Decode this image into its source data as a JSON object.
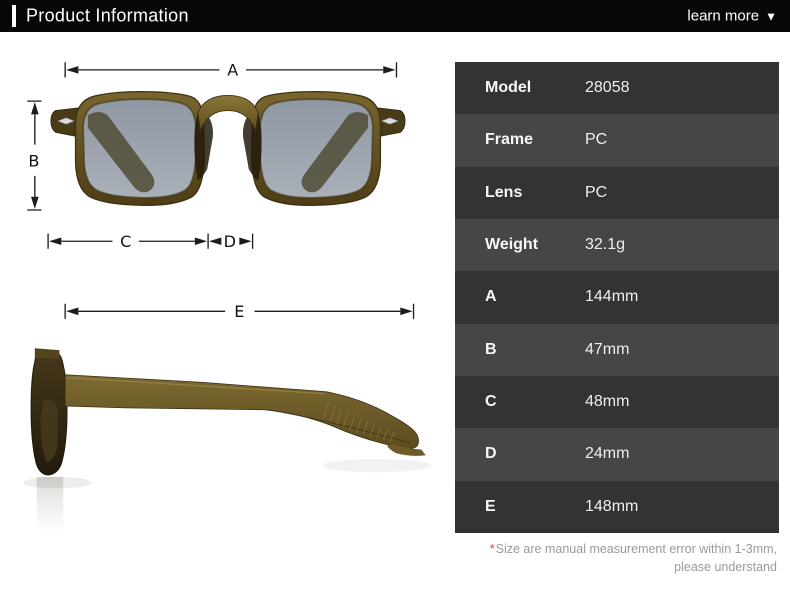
{
  "header": {
    "title": "Product Information",
    "learn_more_label": "learn more",
    "learn_more_icon": "▼"
  },
  "diagram": {
    "dims": {
      "a": "A",
      "b": "B",
      "c": "C",
      "d": "D",
      "e": "E"
    },
    "views": {
      "front": "sunglasses-front-view",
      "side": "sunglasses-side-view"
    }
  },
  "spec_table": {
    "rows": [
      {
        "label": "Model",
        "value": "28058"
      },
      {
        "label": "Frame",
        "value": "PC"
      },
      {
        "label": "Lens",
        "value": "PC"
      },
      {
        "label": "Weight",
        "value": "32.1g"
      },
      {
        "label": "A",
        "value": "144mm"
      },
      {
        "label": "B",
        "value": "47mm"
      },
      {
        "label": "C",
        "value": "48mm"
      },
      {
        "label": "D",
        "value": "24mm"
      },
      {
        "label": "E",
        "value": "148mm"
      }
    ]
  },
  "footnote": {
    "asterisk": "*",
    "line1": "Size are manual measurement error within 1-3mm,",
    "line2": "please understand"
  },
  "colors": {
    "header_bg": "#070707",
    "accent_bar": "#ffffff",
    "row_dark": "#333333",
    "row_light": "#464646",
    "table_text": "#ffffff",
    "footnote_text": "#9a9a9a",
    "footnote_asterisk": "#e03c3c",
    "frame_olive": "#6f5d2a",
    "lens_gray": "#9aa2ad",
    "dimension_lines": "#1c1c1c"
  }
}
